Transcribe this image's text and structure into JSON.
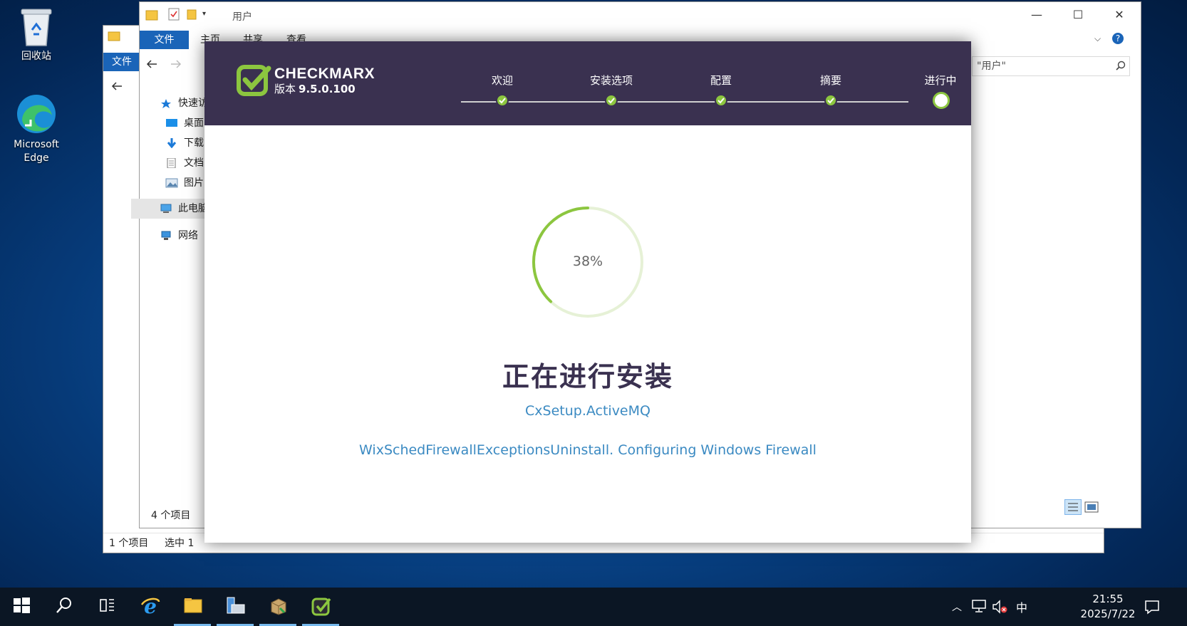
{
  "desktop": {
    "icons": [
      {
        "label": "回收站"
      },
      {
        "label": "Microsoft Edge"
      }
    ]
  },
  "explorer_back": {
    "file_tab": "文件",
    "status_left": "1 个项目",
    "status_right": "选中 1"
  },
  "explorer": {
    "title": "用户",
    "window_controls": {
      "minimize": "—",
      "maximize": "☐",
      "close": "✕"
    },
    "tabs": {
      "file": "文件",
      "home": "主页",
      "share": "共享",
      "view": "查看"
    },
    "search_placeholder": "\"用户\"",
    "nav": {
      "quick_access": "快速访",
      "desktop": "桌面",
      "downloads": "下载",
      "documents": "文档",
      "pictures": "图片",
      "this_pc": "此电脑",
      "network": "网络"
    },
    "status_count": "4 个项目"
  },
  "installer": {
    "brand": "CHECKMARX",
    "version_label": "版本",
    "version": "9.5.0.100",
    "steps": [
      {
        "label": "欢迎",
        "state": "done"
      },
      {
        "label": "安装选项",
        "state": "done"
      },
      {
        "label": "配置",
        "state": "done"
      },
      {
        "label": "摘要",
        "state": "done"
      },
      {
        "label": "进行中",
        "state": "current"
      }
    ],
    "progress_percent": 38,
    "progress_text": "38%",
    "headline": "正在进行安装",
    "component": "CxSetup.ActiveMQ",
    "action": "WixSchedFirewallExceptionsUninstall. Configuring Windows Firewall",
    "colors": {
      "header": "#3a3150",
      "accent": "#8cc63f",
      "link": "#3b8ac2"
    }
  },
  "taskbar": {
    "input_method": "中",
    "time": "21:55",
    "date": "2025/7/22"
  }
}
